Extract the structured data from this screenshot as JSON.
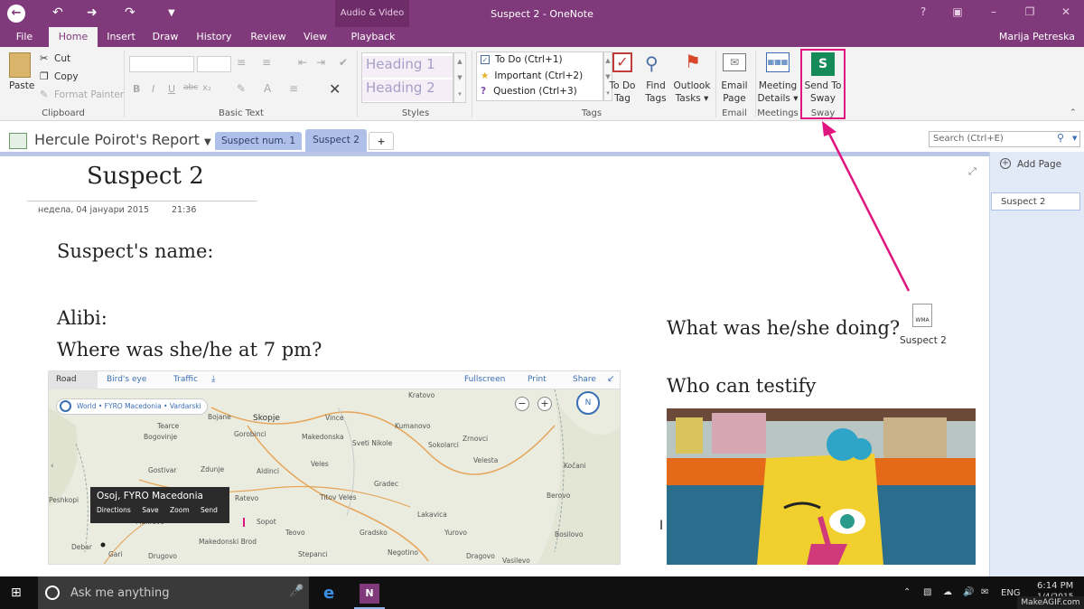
{
  "window": {
    "app_title": "Suspect 2 - OneNote",
    "contextual_group": "Audio & Video",
    "user": "Marija Petreska"
  },
  "ribbon_tabs": [
    "File",
    "Home",
    "Insert",
    "Draw",
    "History",
    "Review",
    "View",
    "Playback"
  ],
  "clipboard": {
    "paste": "Paste",
    "cut": "Cut",
    "copy": "Copy",
    "format_painter": "Format Painter",
    "group": "Clipboard"
  },
  "basic_text": {
    "group": "Basic Text"
  },
  "styles": {
    "heading1": "Heading 1",
    "heading2": "Heading 2",
    "group": "Styles"
  },
  "tags": {
    "items": [
      "To Do (Ctrl+1)",
      "Important (Ctrl+2)",
      "Question (Ctrl+3)"
    ],
    "todo_tag": [
      "To Do",
      "Tag"
    ],
    "find_tags": [
      "Find",
      "Tags"
    ],
    "outlook_tasks": [
      "Outlook",
      "Tasks ▾"
    ],
    "group": "Tags"
  },
  "email": {
    "button": [
      "Email",
      "Page"
    ],
    "group": "Email"
  },
  "meetings": {
    "button": [
      "Meeting",
      "Details ▾"
    ],
    "group": "Meetings"
  },
  "sway": {
    "button": [
      "Send To",
      "Sway"
    ],
    "group": "Sway"
  },
  "notebook": {
    "name": "Hercule Poirot's Report",
    "sections": [
      "Suspect num. 1",
      "Suspect 2"
    ],
    "add_section": "+",
    "search_placeholder": "Search (Ctrl+E)"
  },
  "page": {
    "title": "Suspect 2",
    "date": "недела, 04 јануари 2015",
    "time": "21:36",
    "suspect_name": "Suspect's name:",
    "alibi": "Alibi:",
    "where": "Where was she/he at 7 pm?",
    "what_doing": "What was he/she doing?",
    "who_testify": "Who can testify",
    "attachment_label": "Suspect 2",
    "attachment_ext": "WMA"
  },
  "map": {
    "toolbar": [
      "Road",
      "Bird's eye",
      "Traffic",
      "Fullscreen",
      "Print",
      "Share"
    ],
    "breadcrumb": "World • FYRO Macedonia • Vardarski",
    "popup_title": "Osoj, FYRO Macedonia",
    "popup_actions": [
      "Directions",
      "Save",
      "Zoom",
      "Send"
    ],
    "towns": [
      "Kratovo",
      "Skopje",
      "Bojane",
      "Vince",
      "Kumanovo",
      "Gorobinci",
      "Bogovinje",
      "Tearce",
      "Makedonska",
      "Gostivar",
      "Zdunje",
      "Sveti Nikole",
      "Sokolarci",
      "Zrnovci",
      "Veles",
      "Aldinci",
      "Titov Veles",
      "Berovo",
      "Peshkopi",
      "Debar",
      "Gari",
      "Drugovo",
      "Makedonski Brod",
      "Teovo",
      "Gradsko",
      "Negotino",
      "Stepanci",
      "Lakavica",
      "Vasilevo",
      "Bosilovo",
      "Ratevo",
      "Yurovo",
      "Velesta",
      "Sopot",
      "Makrevo",
      "Gradec",
      "Dragovo",
      "Kočani"
    ]
  },
  "page_pane": {
    "add_page": "Add Page",
    "pages": [
      "Suspect 2"
    ]
  },
  "taskbar": {
    "search": "Ask me anything",
    "lang": "ENG",
    "time": "6:14 PM",
    "date": "1/4/2015",
    "watermark": "MakeAGIF.com"
  },
  "colors": {
    "onenote_purple": "#80397b",
    "highlight_pink": "#e0157f",
    "section_tab_blue": "#aebfe8"
  }
}
